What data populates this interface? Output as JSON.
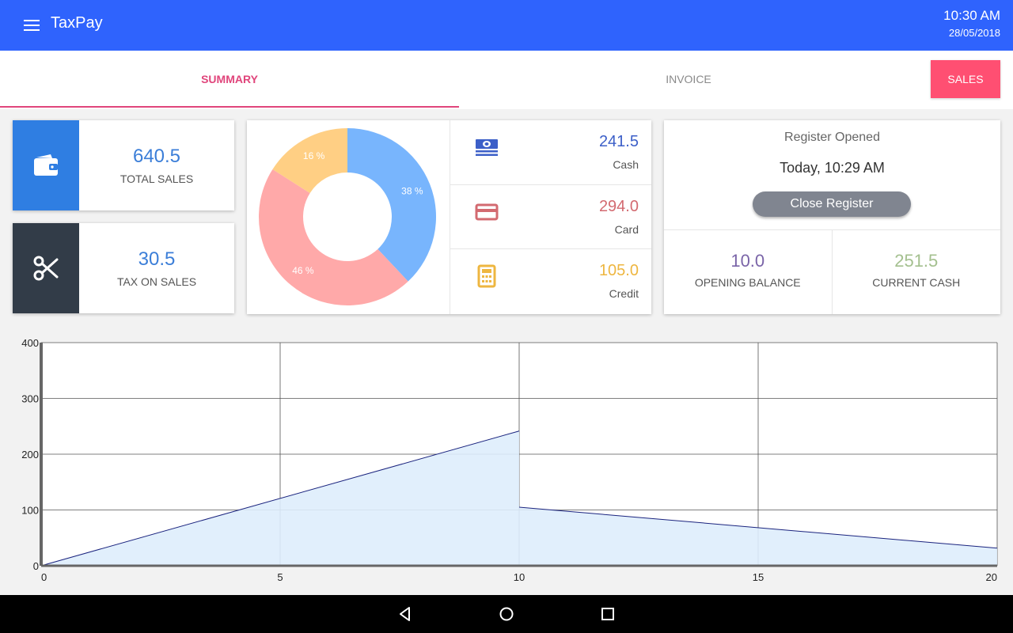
{
  "app": {
    "title": "TaxPay",
    "time": "10:30 AM",
    "date": "28/05/2018"
  },
  "tabs": {
    "summary": "SUMMARY",
    "invoice": "INVOICE",
    "sales": "SALES"
  },
  "stats": {
    "total_sales": {
      "value": "640.5",
      "label": "TOTAL SALES",
      "color": "#2f7ee2"
    },
    "tax_on_sales": {
      "value": "30.5",
      "label": "TAX ON SALES",
      "color": "#323c48"
    }
  },
  "donut": {
    "segments": [
      {
        "label": "38 %",
        "percent": 38,
        "color": "#78b5fd"
      },
      {
        "label": "46 %",
        "percent": 46,
        "color": "#ffa9a9"
      },
      {
        "label": "16 %",
        "percent": 16,
        "color": "#ffcf84"
      }
    ]
  },
  "payment_methods": [
    {
      "value": "241.5",
      "label": "Cash",
      "color": "#3c5fc8",
      "icon": "cash-icon"
    },
    {
      "value": "294.0",
      "label": "Card",
      "color": "#d36a70",
      "icon": "card-icon"
    },
    {
      "value": "105.0",
      "label": "Credit",
      "color": "#eeb640",
      "icon": "calculator-icon"
    }
  ],
  "register": {
    "status": "Register Opened",
    "opened_at": "Today, 10:29 AM",
    "close_label": "Close Register",
    "opening_balance": {
      "value": "10.0",
      "label": "OPENING BALANCE",
      "color": "#7a64a8"
    },
    "current_cash": {
      "value": "251.5",
      "label": "CURRENT CASH",
      "color": "#a4c08f"
    }
  },
  "chart_data": {
    "type": "area",
    "x_ticks": [
      0,
      5,
      10,
      15,
      20
    ],
    "y_ticks": [
      0,
      100,
      200,
      300,
      400
    ],
    "xlim": [
      0,
      20
    ],
    "ylim": [
      0,
      400
    ],
    "grid": true,
    "points": [
      [
        0,
        0
      ],
      [
        10,
        241.5
      ],
      [
        10,
        105.0
      ],
      [
        20,
        31.5
      ]
    ],
    "fill_color": "#deedfc",
    "line_color": "#1a237e"
  }
}
